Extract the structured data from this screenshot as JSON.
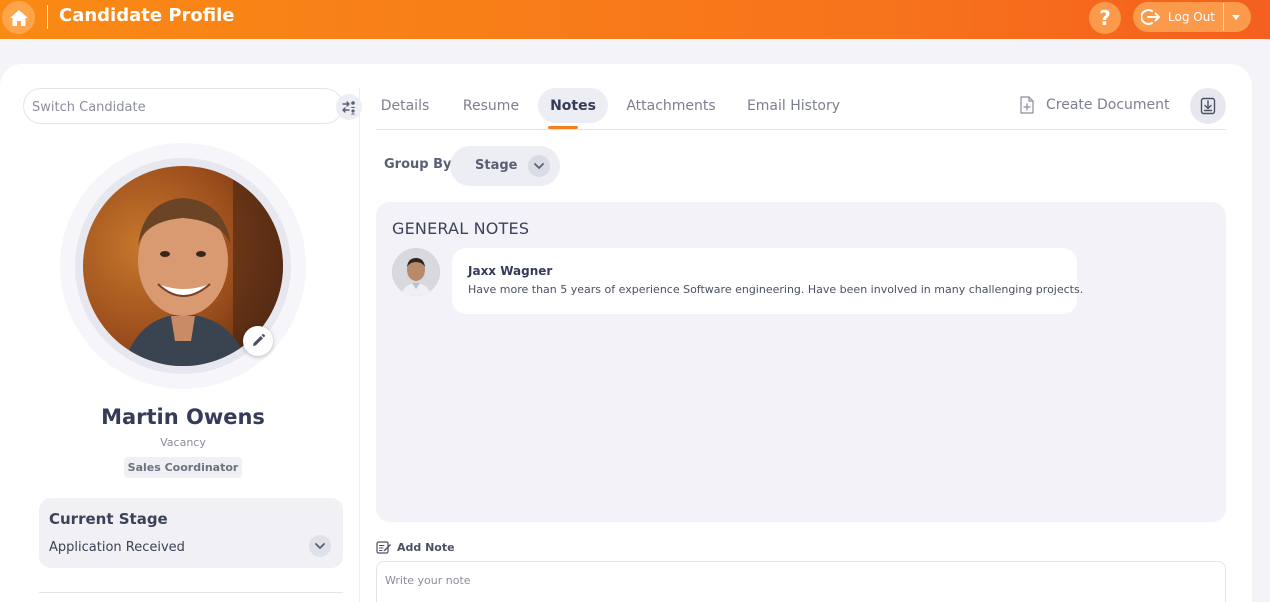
{
  "header": {
    "title": "Candidate Profile",
    "home_icon": "home-icon",
    "help_label": "?",
    "logout_label": "Log Out",
    "logout_icon": "logout-icon",
    "accent": "#f7801a"
  },
  "sidebar": {
    "switch_placeholder": "Switch Candidate",
    "switch_icon": "switch-user-icon",
    "candidate": {
      "name": "Martin Owens",
      "vacancy_label": "Vacancy",
      "vacancy": "Sales Coordinator"
    },
    "stage": {
      "title": "Current Stage",
      "value": "Application Received"
    }
  },
  "tabs": [
    {
      "label": "Details",
      "active": false
    },
    {
      "label": "Resume",
      "active": false
    },
    {
      "label": "Notes",
      "active": true
    },
    {
      "label": "Attachments",
      "active": false
    },
    {
      "label": "Email History",
      "active": false
    }
  ],
  "toolbar": {
    "create_document_label": "Create Document",
    "download_icon": "download-icon"
  },
  "group_by": {
    "label": "Group By",
    "value": "Stage"
  },
  "notes": {
    "heading": "GENERAL NOTES",
    "items": [
      {
        "author": "Jaxx Wagner",
        "text": "Have more than 5 years of experience Software engineering. Have been involved in many challenging projects."
      }
    ],
    "add_label": "Add Note",
    "input_placeholder": "Write your note"
  }
}
